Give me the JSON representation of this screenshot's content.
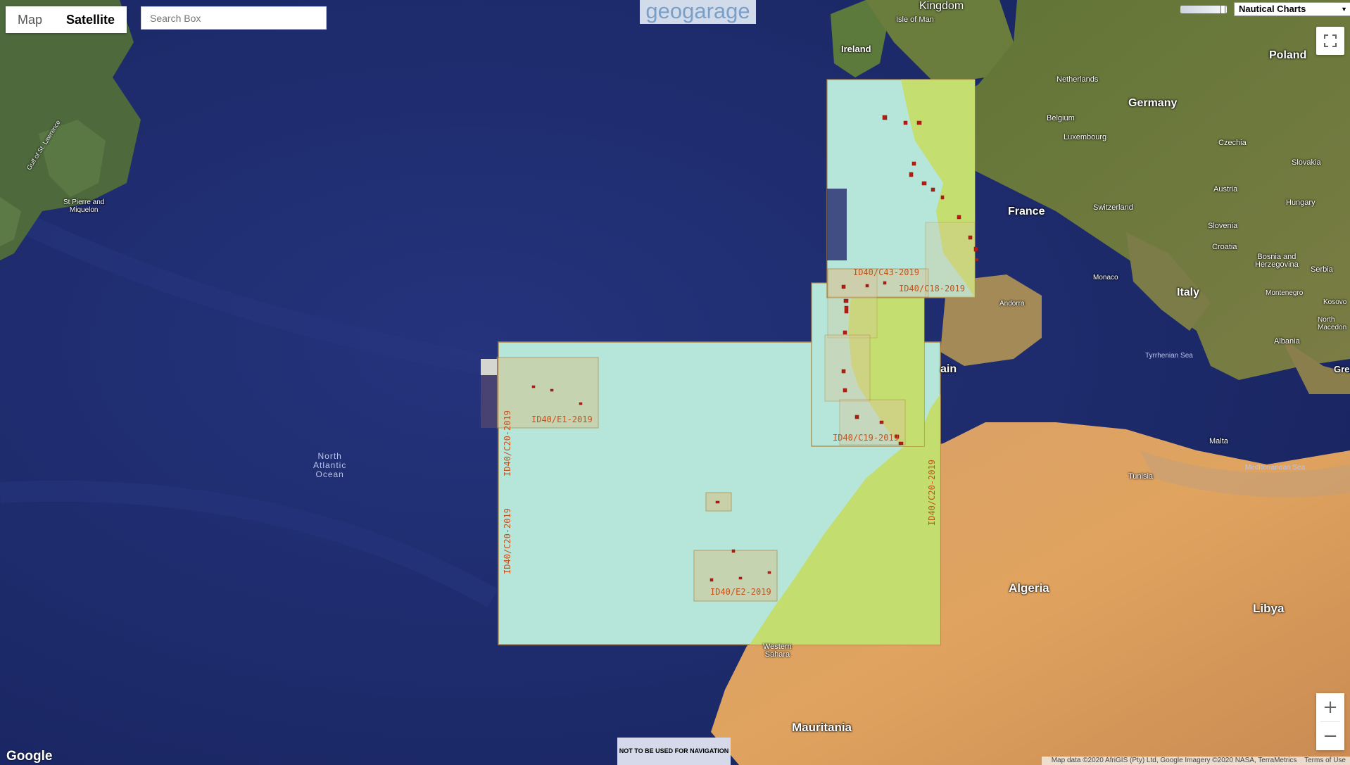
{
  "header": {
    "map_type_buttons": [
      "Map",
      "Satellite"
    ],
    "active_map_type": "Satellite",
    "search_placeholder": "Search Box",
    "logo_text": "geogarage",
    "layer_selected": "Nautical Charts",
    "opacity_slider_level": 0.95
  },
  "icons": [
    "fullscreen-icon",
    "zoom-in-icon",
    "zoom-out-icon",
    "chevron-down-icon"
  ],
  "colors": {
    "ocean": "#1d2a6e",
    "chart_water": "#b6e6d9",
    "chart_land": "#c5dd6a",
    "chart_border": "#b08238",
    "chart_label": "#c2531d",
    "harbour_marker": "#b31c11"
  },
  "chart_labels": {
    "c43": "ID40/C43-2019",
    "c18": "ID40/C18-2019",
    "e1": "ID40/E1-2019",
    "c19": "ID40/C19-2019",
    "e2": "ID40/E2-2019",
    "c20_upper": "ID40/C20-2019",
    "c20_lower": "ID40/C20-2019",
    "c20_right": "ID40/C20-2019"
  },
  "places": {
    "kingdom": "Kingdom",
    "isle_of_man": "Isle of Man",
    "ireland": "Ireland",
    "netherlands": "Netherlands",
    "germany": "Germany",
    "poland": "Poland",
    "belgium": "Belgium",
    "luxembourg": "Luxembourg",
    "czechia": "Czechia",
    "slovakia": "Slovakia",
    "austria": "Austria",
    "hungary": "Hungary",
    "france": "France",
    "switzerland": "Switzerland",
    "slovenia": "Slovenia",
    "croatia": "Croatia",
    "bosnia": "Bosnia and\nHerzegovina",
    "serbia": "Serbia",
    "monaco": "Monaco",
    "italy": "Italy",
    "montenegro": "Montenegro",
    "kosovo": "Kosovo",
    "macedonia": "North\nMacedon",
    "andorra": "Andorra",
    "tyrrhenian": "Tyrrhenian Sea",
    "albania": "Albania",
    "gre": "Gre",
    "ain": "ain",
    "malta": "Malta",
    "tunisia": "Tunisia",
    "mediterranean": "Mediterranean Sea",
    "algeria": "Algeria",
    "libya": "Libya",
    "western_sahara": "Western\nSahara",
    "mauritania": "Mauritania",
    "north_atlantic": "North\nAtlantic\nOcean",
    "st_pierre": "St Pierre and\nMiquelon",
    "gulf_st_lawrence": "Gulf of St. Lawrence"
  },
  "footer": {
    "not_for_navigation": "NOT TO BE USED FOR NAVIGATION",
    "google": "Google",
    "map_data": "Map data ©2020 AfriGIS (Pty) Ltd, Google Imagery ©2020 NASA, TerraMetrics",
    "terms": "Terms of Use"
  }
}
